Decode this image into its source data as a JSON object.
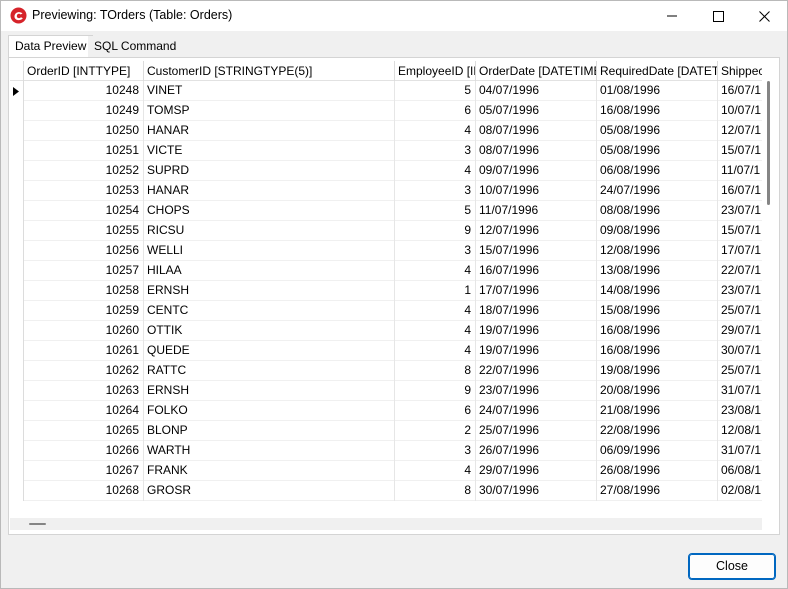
{
  "window": {
    "title": "Previewing: TOrders (Table: Orders)",
    "app_icon": "app-logo-icon",
    "controls": [
      "minimize-icon",
      "maximize-icon",
      "close-icon"
    ]
  },
  "tabs": [
    {
      "label": "Data Preview",
      "active": true
    },
    {
      "label": "SQL Command",
      "active": false
    }
  ],
  "grid": {
    "columns": [
      "OrderID [INTTYPE]",
      "CustomerID [STRINGTYPE(5)]",
      "EmployeeID [IN",
      "OrderDate [DATETIME",
      "RequiredDate [DATETI",
      "Shippec"
    ],
    "rows": [
      [
        "10248",
        "VINET",
        "5",
        "04/07/1996",
        "01/08/1996",
        "16/07/1"
      ],
      [
        "10249",
        "TOMSP",
        "6",
        "05/07/1996",
        "16/08/1996",
        "10/07/1"
      ],
      [
        "10250",
        "HANAR",
        "4",
        "08/07/1996",
        "05/08/1996",
        "12/07/1"
      ],
      [
        "10251",
        "VICTE",
        "3",
        "08/07/1996",
        "05/08/1996",
        "15/07/1"
      ],
      [
        "10252",
        "SUPRD",
        "4",
        "09/07/1996",
        "06/08/1996",
        "11/07/1"
      ],
      [
        "10253",
        "HANAR",
        "3",
        "10/07/1996",
        "24/07/1996",
        "16/07/1"
      ],
      [
        "10254",
        "CHOPS",
        "5",
        "11/07/1996",
        "08/08/1996",
        "23/07/1"
      ],
      [
        "10255",
        "RICSU",
        "9",
        "12/07/1996",
        "09/08/1996",
        "15/07/1"
      ],
      [
        "10256",
        "WELLI",
        "3",
        "15/07/1996",
        "12/08/1996",
        "17/07/1"
      ],
      [
        "10257",
        "HILAA",
        "4",
        "16/07/1996",
        "13/08/1996",
        "22/07/1"
      ],
      [
        "10258",
        "ERNSH",
        "1",
        "17/07/1996",
        "14/08/1996",
        "23/07/1"
      ],
      [
        "10259",
        "CENTC",
        "4",
        "18/07/1996",
        "15/08/1996",
        "25/07/1"
      ],
      [
        "10260",
        "OTTIK",
        "4",
        "19/07/1996",
        "16/08/1996",
        "29/07/1"
      ],
      [
        "10261",
        "QUEDE",
        "4",
        "19/07/1996",
        "16/08/1996",
        "30/07/1"
      ],
      [
        "10262",
        "RATTC",
        "8",
        "22/07/1996",
        "19/08/1996",
        "25/07/1"
      ],
      [
        "10263",
        "ERNSH",
        "9",
        "23/07/1996",
        "20/08/1996",
        "31/07/1"
      ],
      [
        "10264",
        "FOLKO",
        "6",
        "24/07/1996",
        "21/08/1996",
        "23/08/1"
      ],
      [
        "10265",
        "BLONP",
        "2",
        "25/07/1996",
        "22/08/1996",
        "12/08/1"
      ],
      [
        "10266",
        "WARTH",
        "3",
        "26/07/1996",
        "06/09/1996",
        "31/07/1"
      ],
      [
        "10267",
        "FRANK",
        "4",
        "29/07/1996",
        "26/08/1996",
        "06/08/1"
      ],
      [
        "10268",
        "GROSR",
        "8",
        "30/07/1996",
        "27/08/1996",
        "02/08/1"
      ]
    ],
    "current_row_indicator_icon": "row-pointer-icon"
  },
  "buttons": {
    "close_label": "Close"
  },
  "colors": {
    "accent": "#0067c0",
    "app_icon_red": "#d6232a"
  }
}
